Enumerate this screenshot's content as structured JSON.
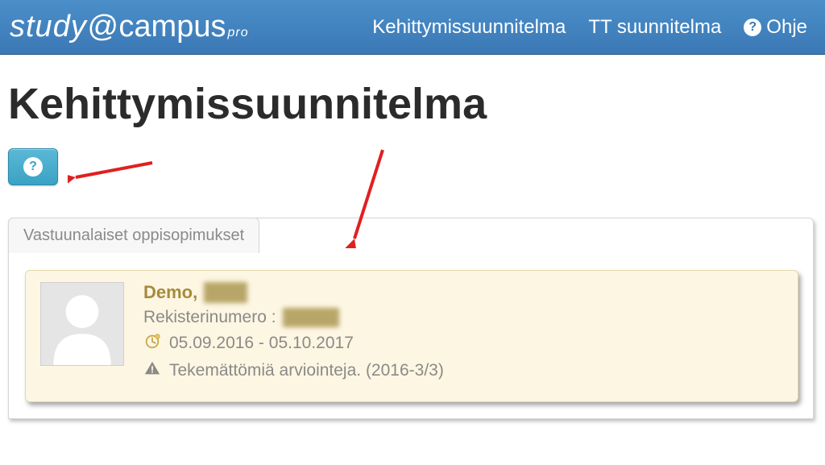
{
  "logo": {
    "study": "study",
    "at": "@",
    "campus": "campus",
    "pro": "pro"
  },
  "nav": {
    "plan": "Kehittymissuunnitelma",
    "tt": "TT suunnitelma",
    "help": "Ohje"
  },
  "page": {
    "title": "Kehittymissuunnitelma"
  },
  "tabs": {
    "responsible": "Vastuunalaiset oppisopimukset"
  },
  "student": {
    "name_known": "Demo,",
    "name_blurred": "Erkki",
    "reg_label": "Rekisterinumero :",
    "reg_value_blurred": "123456",
    "date_range": "05.09.2016 - 05.10.2017",
    "warning": "Tekemättömiä arviointeja. (2016-3/3)"
  },
  "icons": {
    "help": "?",
    "clock": "clock-icon",
    "warning": "warning-icon",
    "avatar": "person-icon"
  }
}
